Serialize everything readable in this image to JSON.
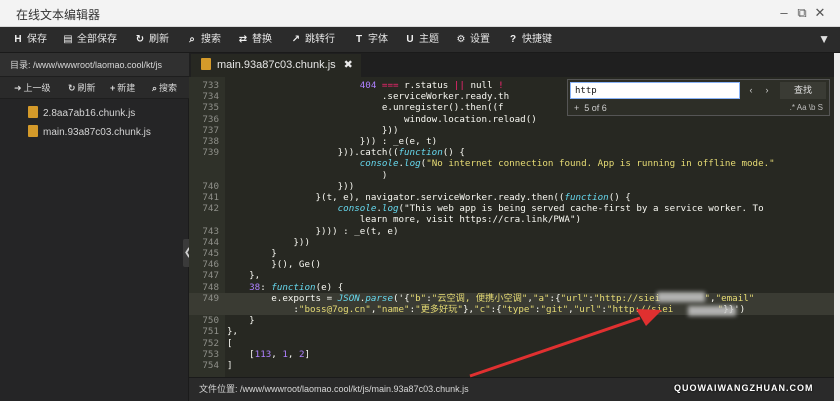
{
  "window": {
    "title": "在线文本编辑器"
  },
  "toolbar": {
    "items": [
      {
        "icon": "save-icon",
        "glyph": "H",
        "label": "保存"
      },
      {
        "icon": "save-all-icon",
        "glyph": "▤",
        "label": "全部保存"
      },
      {
        "icon": "refresh-icon",
        "glyph": "↻",
        "label": "刷新"
      },
      {
        "icon": "search-icon",
        "glyph": "⌕",
        "label": "搜索"
      },
      {
        "icon": "replace-icon",
        "glyph": "⇄",
        "label": "替换"
      },
      {
        "icon": "goto-line-icon",
        "glyph": "↗",
        "label": "跳转行"
      },
      {
        "icon": "font-icon",
        "glyph": "T",
        "label": "字体"
      },
      {
        "icon": "theme-icon",
        "glyph": "U",
        "label": "主题"
      },
      {
        "icon": "gear-icon",
        "glyph": "⚙",
        "label": "设置"
      },
      {
        "icon": "help-icon",
        "glyph": "?",
        "label": "快捷键"
      }
    ]
  },
  "sidebar": {
    "directory_label": "目录: /www/wwwroot/laomao.cool/kt/js",
    "nav": [
      {
        "icon": "up-icon",
        "glyph": "➜",
        "label": "上一级"
      },
      {
        "icon": "refresh-icon",
        "glyph": "↻",
        "label": "刷新"
      },
      {
        "icon": "plus-icon",
        "glyph": "+",
        "label": "新建"
      },
      {
        "icon": "search-icon",
        "glyph": "⌕",
        "label": "搜索"
      }
    ],
    "files": [
      "2.8aa7ab16.chunk.js",
      "main.93a87c03.chunk.js"
    ]
  },
  "tab": {
    "filename": "main.93a87c03.chunk.js",
    "close_glyph": "✖"
  },
  "search": {
    "value": "http",
    "count": "5 of 6",
    "find_label": "查找",
    "options": ".* Aa \\b S"
  },
  "code_lines": [
    {
      "n": "733",
      "t": "                        404 === r.status || null !"
    },
    {
      "n": "734",
      "t": "                            .serviceWorker.ready.th"
    },
    {
      "n": "735",
      "t": "                            e.unregister().then((f"
    },
    {
      "n": "736",
      "t": "                                window.location.reload()"
    },
    {
      "n": "737",
      "t": "                            }))"
    },
    {
      "n": "738",
      "t": "                        })) : _e(e, t)"
    },
    {
      "n": "739",
      "t": "                    })).catch((function() {"
    },
    {
      "n": "",
      "t": "                        console.log(\"No internet connection found. App is running in offline mode.\""
    },
    {
      "n": "",
      "t": "                            )"
    },
    {
      "n": "740",
      "t": "                    }))"
    },
    {
      "n": "741",
      "t": "                }(t, e), navigator.serviceWorker.ready.then((function() {"
    },
    {
      "n": "742",
      "t": "                    console.log(\"This web app is being served cache-first by a service worker. To"
    },
    {
      "n": "",
      "t": "                        learn more, visit https://cra.link/PWA\")"
    },
    {
      "n": "743",
      "t": "                }))) : _e(t, e)"
    },
    {
      "n": "744",
      "t": "            }))"
    },
    {
      "n": "745",
      "t": "        }"
    },
    {
      "n": "746",
      "t": "        }(), Ge()"
    },
    {
      "n": "747",
      "t": "    },"
    },
    {
      "n": "748",
      "t": "    38: function(e) {"
    },
    {
      "n": "749",
      "t": "        e.exports = JSON.parse('{\"b\":\"云空调, 便携小空调\",\"a\":{\"url\":\"http://siei        \",\"email\""
    },
    {
      "n": "",
      "t": "            :\"boss@7og.cn\",\"name\":\"更多好玩\"},\"c\":{\"type\":\"git\",\"url\":\"http://siei        \"}}')"
    },
    {
      "n": "750",
      "t": "    }"
    },
    {
      "n": "751",
      "t": "},"
    },
    {
      "n": "752",
      "t": "["
    },
    {
      "n": "753",
      "t": "    [113, 1, 2]"
    },
    {
      "n": "754",
      "t": "]"
    }
  ],
  "status": {
    "path_label": "文件位置: /www/wwwroot/laomao.cool/kt/js/main.93a87c03.chunk.js"
  },
  "watermark": "QUOWAIWANGZHUAN.COM",
  "colors": {
    "arrow": "#e03030",
    "keyword": "#f92672",
    "string": "#e6db74"
  }
}
